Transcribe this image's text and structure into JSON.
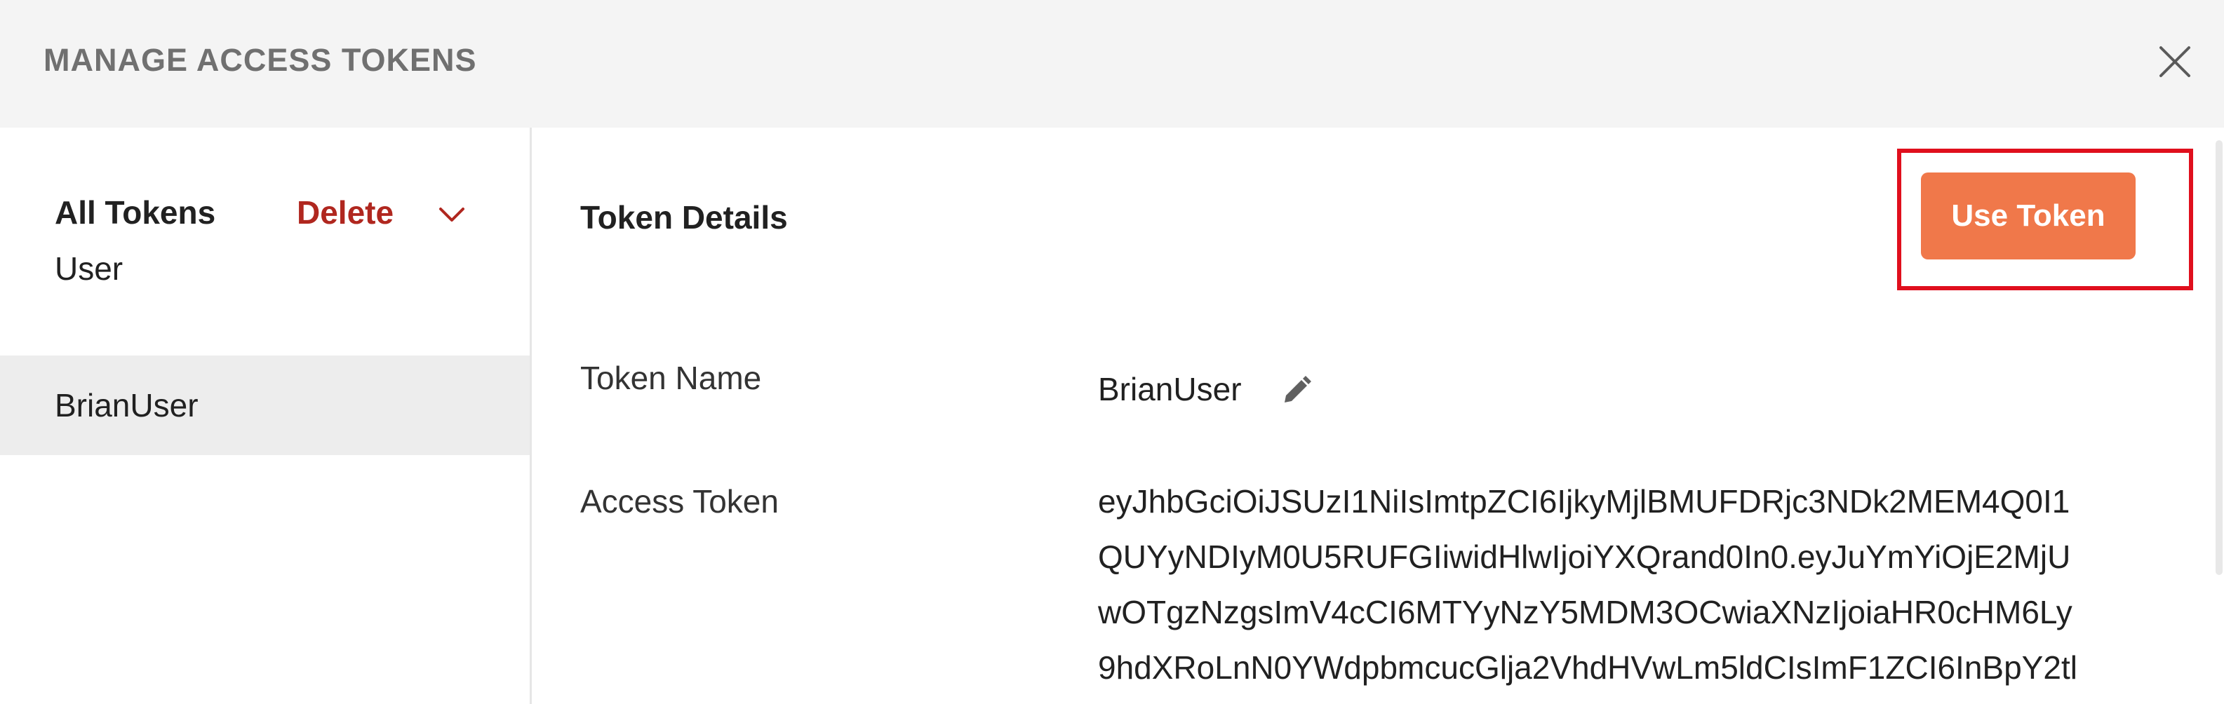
{
  "header": {
    "title": "MANAGE ACCESS TOKENS"
  },
  "sidebar": {
    "title": "All Tokens",
    "delete_label": "Delete",
    "items": [
      {
        "label": "User"
      },
      {
        "label": "BrianUser",
        "selected": true
      }
    ]
  },
  "main": {
    "heading": "Token Details",
    "use_token_label": "Use Token",
    "fields": {
      "token_name_label": "Token Name",
      "token_name_value": "BrianUser",
      "access_token_label": "Access Token",
      "access_token_lines": [
        "eyJhbGciOiJSUzI1NiIsImtpZCI6IjkyMjlBMUFDRjc3NDk2MEM4Q0I1",
        "QUYyNDIyM0U5RUFGIiwidHlwIjoiYXQrand0In0.eyJuYmYiOjE2MjU",
        "wOTgzNzgsImV4cCI6MTYyNzY5MDM3OCwiaXNzIjoiaHR0cHM6Ly",
        "9hdXRoLnN0YWdpbmcucGlja2VhdHVwLm5ldCIsImF1ZCI6InBpY2tl"
      ]
    }
  },
  "colors": {
    "accent": "#f0784a",
    "delete": "#b0271f",
    "highlight": "#e00f1d",
    "header_bg": "#f4f4f4",
    "selected_bg": "#ededed"
  },
  "icons": [
    "close-icon",
    "chevron-down-icon",
    "pencil-icon"
  ]
}
